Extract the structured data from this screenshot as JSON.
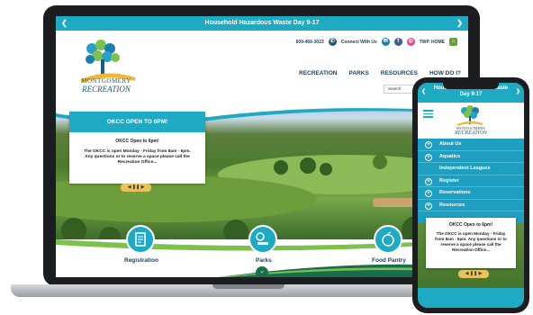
{
  "laptop": {
    "alert_title": "Household Hazardous Waste Day 9-17",
    "alert_prev": "❮",
    "alert_next": "❯",
    "logo_line1": "MONTGOMERY",
    "logo_line2": "RECREATION",
    "phone_number": "609-466-3023",
    "connect_label": "Connect With Us",
    "twp_home": "TWP. HOME",
    "nav": [
      "RECREATION",
      "PARKS",
      "RESOURCES",
      "HOW DO I?"
    ],
    "search_placeholder": "Search",
    "card_title": "OKCC OPEN TO 6PM!",
    "card_subtitle": "OKCC Open to 6pm!",
    "card_body": "The OKCC is open Monday - Friday from 8am - 6pm. Any questions or to reserve a space please call the Recreation Office...",
    "pager": "◀ ❚❚ ▶",
    "services": [
      "Registration",
      "Parks",
      "Food Pantry"
    ]
  },
  "phone": {
    "alert_prev": "❮",
    "alert_title_1": "Household Hazardous Waste",
    "alert_title_2": "Day 9-17",
    "alert_next": "❯",
    "logo_line1": "MONTGOMERY",
    "logo_line2": "RECREATION",
    "menu": [
      "About Us",
      "Aquatics",
      "Independent Leagues",
      "Register",
      "Reservations",
      "Resources"
    ],
    "menu_plus": "+",
    "card_subtitle": "OKCC Open to 6pm!",
    "card_body": "The OKCC is open Monday - Friday from 8am - 6pm. Any questions or to reserve a space please call the Recreation Office...",
    "pager": "◀ ❚❚ ▶"
  },
  "colors": {
    "accent": "#1faac4",
    "navy": "#1a3f5c",
    "pager": "#e8c25a"
  }
}
